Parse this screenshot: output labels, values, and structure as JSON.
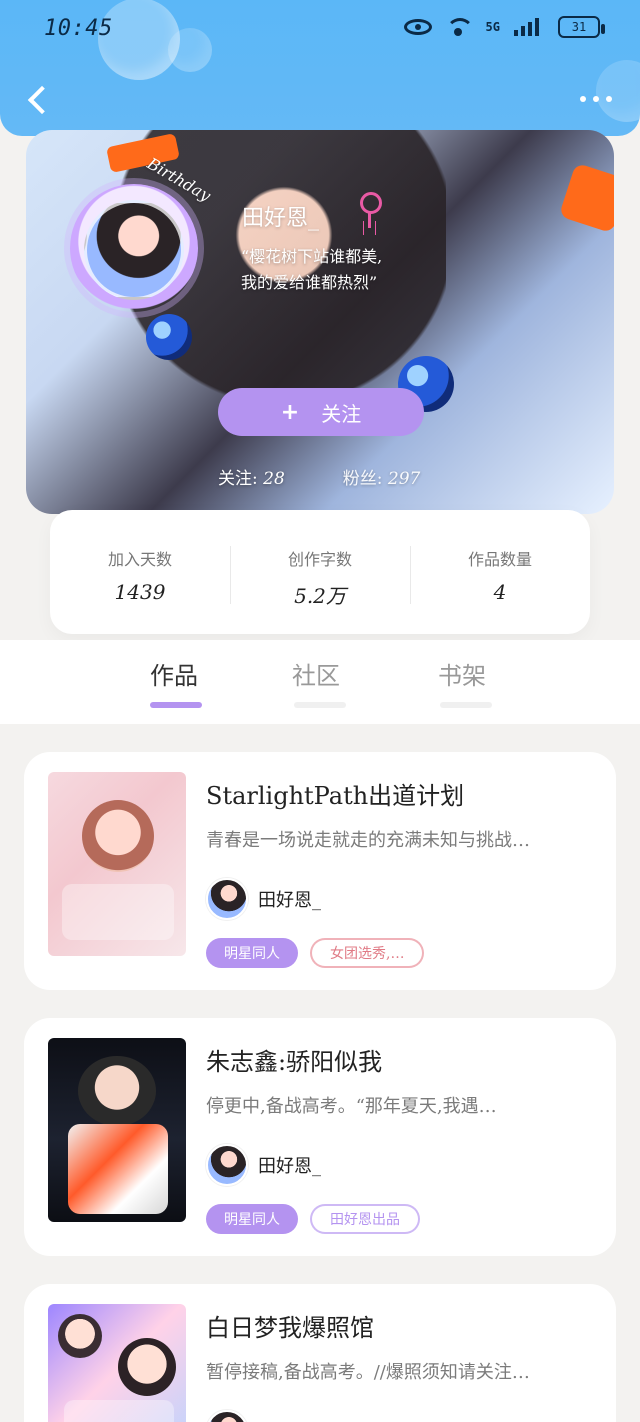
{
  "status": {
    "time": "10:45",
    "network": "5G",
    "battery": "31"
  },
  "header": {
    "back_icon": "back-arrow-icon",
    "more_icon": "more-dots-icon"
  },
  "profile": {
    "badge_text": "Birthday",
    "name": "田好恩_",
    "quote_line1": "“樱花树下站谁都美,",
    "quote_line2": "我的爱给谁都热烈”",
    "follow_plus": "+",
    "follow_label": "关注",
    "following_label": "关注:",
    "following_count": "28",
    "fans_label": "粉丝:",
    "fans_count": "297"
  },
  "stats": {
    "join_days_label": "加入天数",
    "join_days_value": "1439",
    "words_label": "创作字数",
    "words_value": "5.2万",
    "works_label": "作品数量",
    "works_value": "4"
  },
  "tabs": [
    {
      "label": "作品",
      "active": true
    },
    {
      "label": "社区",
      "active": false
    },
    {
      "label": "书架",
      "active": false
    }
  ],
  "works": [
    {
      "title": "StarlightPath出道计划",
      "desc": "青春是一场说走就走的充满未知与挑战…",
      "author": "田好恩_",
      "tag1": "明星同人",
      "tag2": "女团选秀,…"
    },
    {
      "title": "朱志鑫:骄阳似我",
      "desc": "停更中,备战高考。“那年夏天,我遇…",
      "author": "田好恩_",
      "tag1": "明星同人",
      "tag2": "田好恩出品"
    },
    {
      "title": "白日梦我爆照馆",
      "desc": "暂停接稿,备战高考。//爆照须知请关注…",
      "author": "",
      "tag1": "",
      "tag2": ""
    }
  ]
}
